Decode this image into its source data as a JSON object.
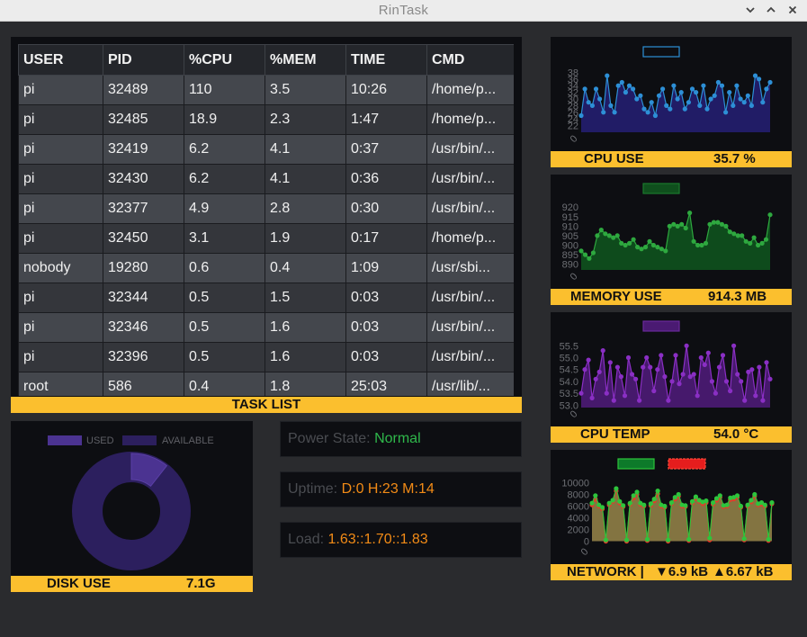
{
  "window": {
    "title": "RinTask"
  },
  "task_list": {
    "label": "TASK LIST",
    "columns": [
      "USER",
      "PID",
      "%CPU",
      "%MEM",
      "TIME",
      "CMD"
    ],
    "rows": [
      [
        "pi",
        "32489",
        "110",
        "3.5",
        "10:26",
        "/home/p..."
      ],
      [
        "pi",
        "32485",
        "18.9",
        "2.3",
        "1:47",
        "/home/p..."
      ],
      [
        "pi",
        "32419",
        "6.2",
        "4.1",
        "0:37",
        "/usr/bin/..."
      ],
      [
        "pi",
        "32430",
        "6.2",
        "4.1",
        "0:36",
        "/usr/bin/..."
      ],
      [
        "pi",
        "32377",
        "4.9",
        "2.8",
        "0:30",
        "/usr/bin/..."
      ],
      [
        "pi",
        "32450",
        "3.1",
        "1.9",
        "0:17",
        "/home/p..."
      ],
      [
        "nobody",
        "19280",
        "0.6",
        "0.4",
        "1:09",
        "/usr/sbi..."
      ],
      [
        "pi",
        "32344",
        "0.5",
        "1.5",
        "0:03",
        "/usr/bin/..."
      ],
      [
        "pi",
        "32346",
        "0.5",
        "1.6",
        "0:03",
        "/usr/bin/..."
      ],
      [
        "pi",
        "32396",
        "0.5",
        "1.6",
        "0:03",
        "/usr/bin/..."
      ],
      [
        "root",
        "586",
        "0.4",
        "1.8",
        "25:03",
        "/usr/lib/..."
      ]
    ]
  },
  "disk": {
    "label": "DISK USE",
    "value": "7.1G",
    "legend_used": "USED",
    "legend_available": "AVAILABLE",
    "used_color": "#4b3391",
    "available_color": "#2c1f5e"
  },
  "status": {
    "power_label": "Power State:",
    "power_value": "Normal",
    "power_color": "#2fb84b",
    "uptime_label": "Uptime:",
    "uptime_value": "D:0 H:23 M:14",
    "load_label": "Load:",
    "load_value": "1.63::1.70::1.83",
    "value_color": "#f28b16"
  },
  "cpu": {
    "label": "CPU USE",
    "value": "35.7 %"
  },
  "memory": {
    "label": "MEMORY USE",
    "value": "914.3 MB"
  },
  "temp": {
    "label": "CPU TEMP",
    "value": "54.0 °C"
  },
  "network": {
    "label": "NETWORK |",
    "down_value": "6.9 kB",
    "up_value": "6.67 kB"
  },
  "chart_data": [
    {
      "id": "cpu",
      "type": "area",
      "ylim": [
        20,
        40
      ],
      "yticks": [
        22,
        24,
        26,
        28,
        30,
        32,
        34,
        36,
        38
      ],
      "xticks": [
        "0"
      ],
      "line_color": "#2d8fd6",
      "fill_color": "#231d6b",
      "series": [
        {
          "values": [
            25,
            33,
            29,
            28,
            33,
            30,
            26,
            37,
            28,
            26,
            34,
            35,
            32,
            34,
            33,
            30,
            31,
            27,
            26,
            29,
            25,
            31,
            33,
            28,
            27,
            34,
            30,
            32,
            27,
            29,
            33,
            32,
            28,
            34,
            27,
            30,
            31,
            35,
            34,
            26,
            32,
            28,
            34,
            30,
            29,
            31,
            28,
            37,
            36,
            29,
            33,
            35
          ]
        }
      ]
    },
    {
      "id": "memory",
      "type": "area",
      "ylim": [
        887,
        922
      ],
      "yticks": [
        890,
        895,
        900,
        905,
        910,
        915,
        920
      ],
      "xticks": [
        "0"
      ],
      "line_color": "#2ea83f",
      "fill_color": "#0f4f1d",
      "series": [
        {
          "values": [
            897,
            895,
            893,
            896,
            905,
            908,
            906,
            905,
            904,
            905,
            901,
            900,
            901,
            903,
            899,
            898,
            899,
            902,
            900,
            899,
            898,
            897,
            910,
            911,
            910,
            911,
            909,
            917,
            902,
            900,
            900,
            901,
            911,
            912,
            912,
            911,
            910,
            907,
            906,
            905,
            905,
            902,
            901,
            904,
            900,
            901,
            903,
            916
          ]
        }
      ]
    },
    {
      "id": "temp",
      "type": "area",
      "ylim": [
        52.9,
        55.7
      ],
      "yticks": [
        53.0,
        53.5,
        54.0,
        54.5,
        55.0,
        55.5
      ],
      "xticks": [
        "0"
      ],
      "line_color": "#8a2fc4",
      "fill_color": "#4a1a72",
      "series": [
        {
          "values": [
            53.5,
            54.5,
            54.9,
            53.3,
            54.1,
            54.4,
            55.3,
            53.5,
            54.8,
            53.2,
            54.6,
            54.2,
            53.4,
            55.0,
            54.3,
            54.1,
            53.2,
            54.6,
            55.0,
            54.6,
            53.6,
            54.5,
            55.1,
            54.2,
            53.2,
            54.0,
            55.1,
            53.9,
            54.3,
            55.5,
            54.2,
            54.3,
            53.4,
            55.0,
            54.7,
            55.2,
            54.0,
            53.5,
            54.6,
            55.1,
            54.0,
            53.6,
            55.5,
            54.3,
            54.0,
            53.2,
            54.4,
            54.5,
            53.4,
            54.6,
            53.2,
            54.8,
            54.1
          ]
        }
      ]
    },
    {
      "id": "network",
      "type": "area",
      "ylim": [
        -700,
        11000
      ],
      "yticks": [
        0,
        2000,
        4000,
        6000,
        8000,
        10000
      ],
      "xticks": [
        "0"
      ],
      "fill_color": "#8a7a45",
      "series": [
        {
          "name": "down",
          "color": "#2ec43c",
          "values": [
            6500,
            7800,
            6200,
            5800,
            200,
            6500,
            7000,
            9000,
            6800,
            6100,
            200,
            6500,
            7800,
            8400,
            6500,
            6200,
            300,
            6400,
            7200,
            8600,
            6200,
            6000,
            200,
            6600,
            7500,
            8000,
            6200,
            6100,
            300,
            6800,
            7600,
            7000,
            6700,
            6900,
            500,
            6600,
            7300,
            7800,
            6100,
            6200,
            7400,
            7500,
            7800,
            6000,
            400,
            6200,
            7000,
            8000,
            6400,
            6600,
            6200,
            300,
            6600
          ]
        },
        {
          "name": "up",
          "color": "#e53a2a",
          "values": [
            6200,
            7200,
            6000,
            5500,
            0,
            6200,
            6800,
            8600,
            6500,
            5900,
            0,
            6300,
            7400,
            8000,
            6300,
            6000,
            100,
            6100,
            6900,
            8100,
            6000,
            5800,
            0,
            6400,
            7200,
            7700,
            6000,
            5900,
            100,
            6500,
            7300,
            6800,
            6400,
            6600,
            200,
            6300,
            7000,
            7500,
            5900,
            6000,
            7100,
            7200,
            7500,
            5800,
            200,
            6000,
            6700,
            7700,
            6200,
            6300,
            6000,
            100,
            6400
          ]
        }
      ]
    }
  ]
}
